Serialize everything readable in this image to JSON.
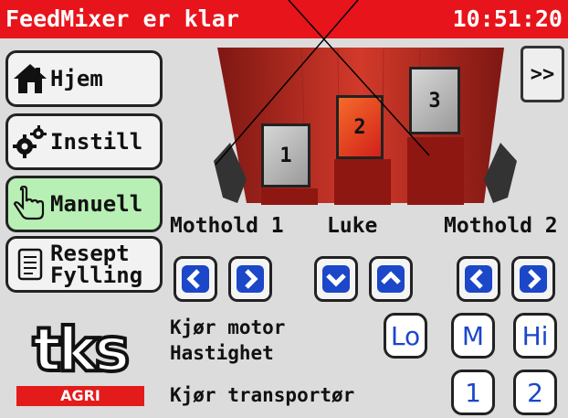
{
  "titlebar": {
    "title": "FeedMixer er klar",
    "clock": "10:51:20",
    "background": "#e8141b"
  },
  "nav": {
    "home_label": "Hjem",
    "settings_label": "Instill",
    "manual_label": "Manuell",
    "recipe_label_line1": "Resept",
    "recipe_label_line2": "Fylling",
    "active_item": "Manuell",
    "active_color": "#b8efb4"
  },
  "page_button": {
    "label": ">>"
  },
  "mixer": {
    "hatches": [
      {
        "label": "1",
        "selected": false
      },
      {
        "label": "2",
        "selected": true
      },
      {
        "label": "3",
        "selected": false
      }
    ],
    "body_color": "#c62e22"
  },
  "controls": {
    "mothold1_label": "Mothold 1",
    "luke_label": "Luke",
    "mothold2_label": "Mothold 2",
    "motor_label": "Kjør motor",
    "speed_label": "Hastighet",
    "conveyor_label": "Kjør transportør",
    "speed_buttons": [
      "Lo",
      "M",
      "Hi"
    ],
    "conveyor_buttons": [
      "1",
      "2"
    ],
    "arrow_color": "#1b47c8"
  },
  "logo": {
    "brand_text": "tks",
    "sub_text": "AGRI"
  }
}
